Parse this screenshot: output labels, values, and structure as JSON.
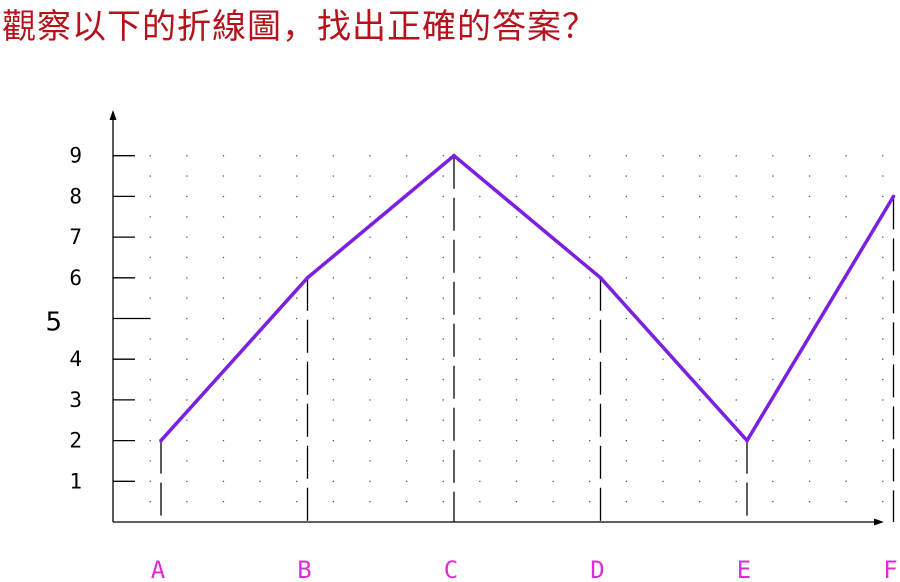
{
  "question": {
    "text": "觀察以下的折線圖，找出正確的答案？",
    "color": "#b5121b"
  },
  "chart_data": {
    "type": "line",
    "title": "",
    "xlabel": "",
    "ylabel": "",
    "categories": [
      "A",
      "B",
      "C",
      "D",
      "E",
      "F"
    ],
    "values": [
      2,
      6,
      9,
      6,
      2,
      8
    ],
    "ylim": [
      0,
      9
    ],
    "yticks": [
      "1",
      "2",
      "3",
      "4",
      "5",
      "6",
      "7",
      "8",
      "9"
    ],
    "grid": "dotted",
    "colors": {
      "line": "#7b1fe0",
      "category_labels": "#e02ad8",
      "axis": "#000000",
      "grid": "#555555"
    }
  }
}
